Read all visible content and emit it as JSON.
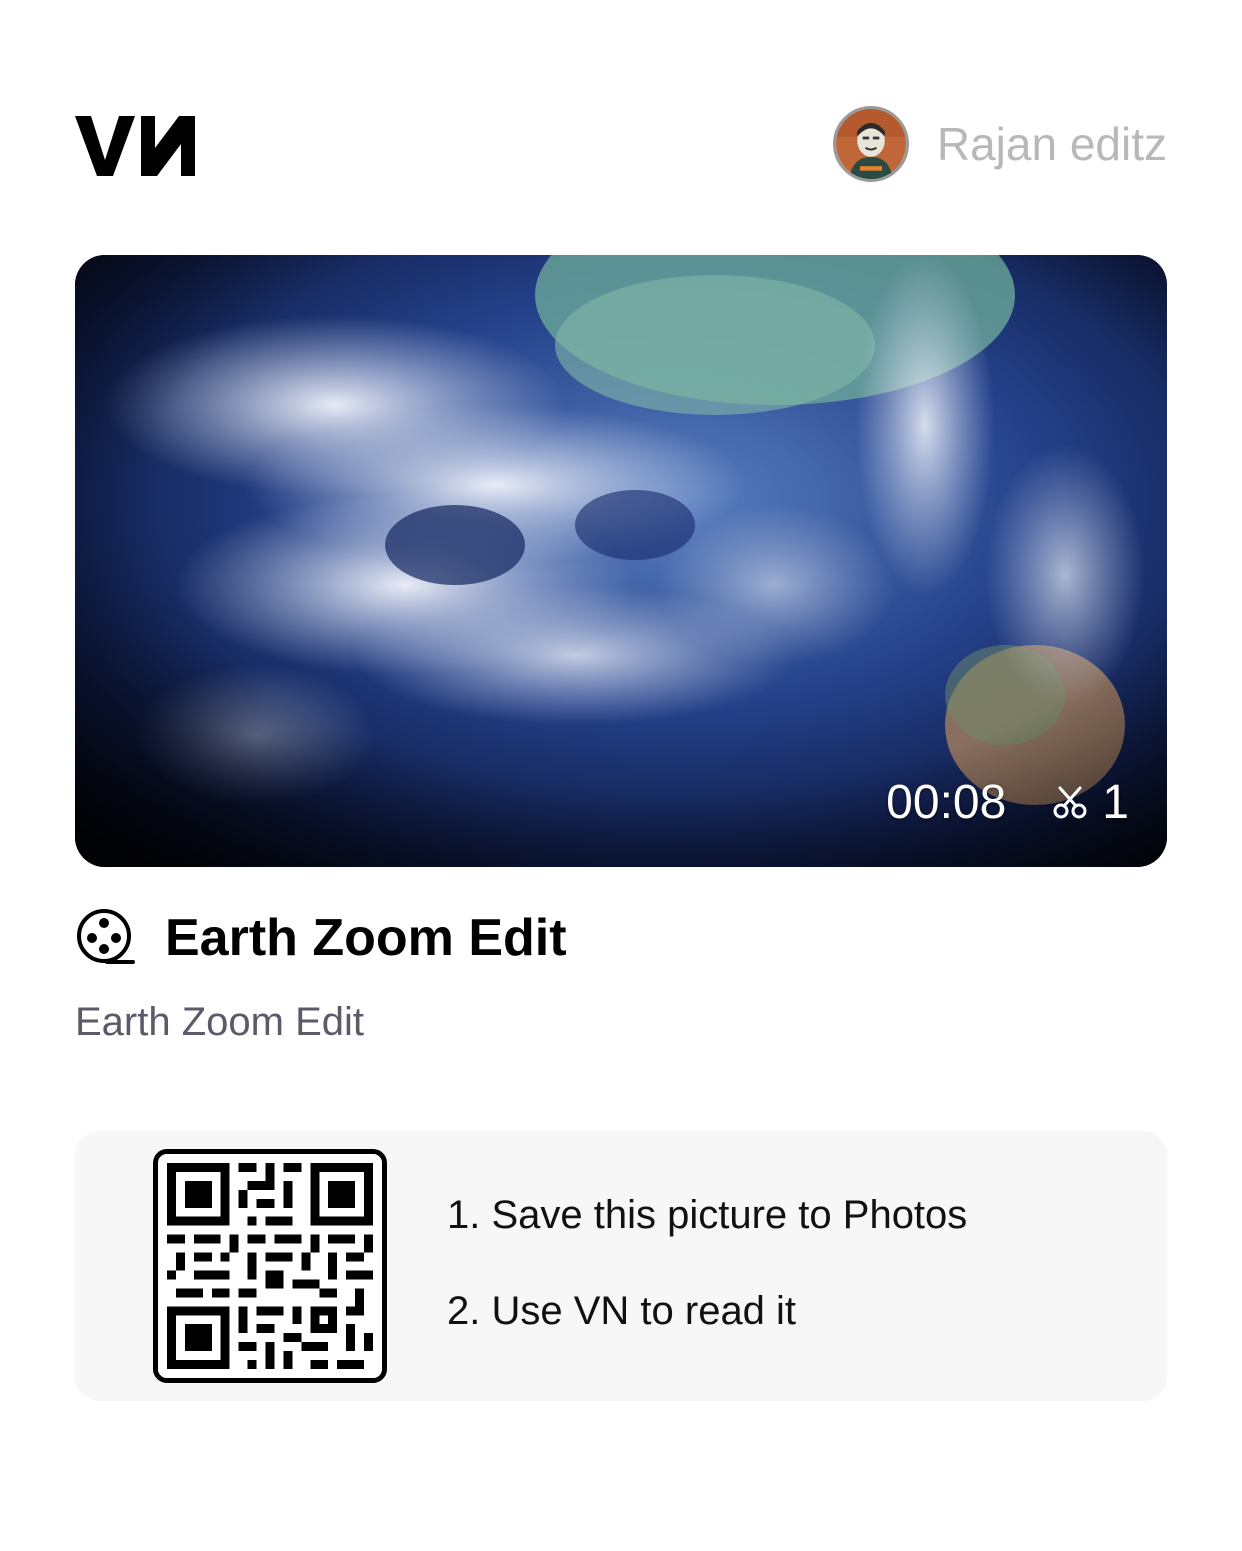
{
  "header": {
    "logo_text": "VN",
    "username": "Rajan editz",
    "avatar_icon": "avatar-icon"
  },
  "video": {
    "duration": "00:08",
    "clip_count": "1",
    "clip_icon": "scissors-icon"
  },
  "project": {
    "title": "Earth Zoom Edit",
    "description": "Earth Zoom Edit",
    "title_icon": "film-reel-icon"
  },
  "qr_card": {
    "steps": [
      "1. Save this picture to Photos",
      "2. Use VN to read it"
    ]
  },
  "colors": {
    "background": "#ffffff",
    "username": "#b8b8b8",
    "subtitle": "#5a5a68",
    "card": "#f7f7f7"
  }
}
